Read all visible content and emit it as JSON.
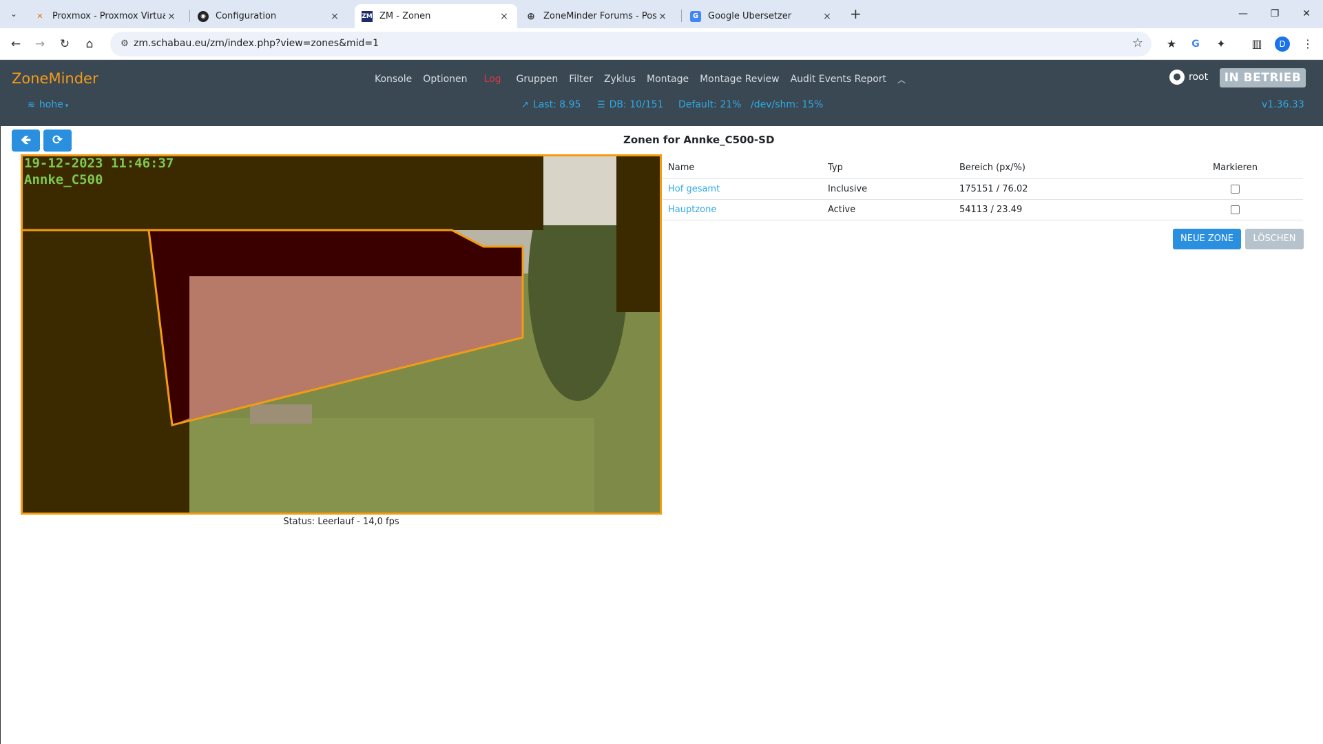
{
  "browser": {
    "tabs": [
      {
        "title": "Proxmox - Proxmox Virtual Env",
        "icon": "proxmox-icon",
        "active": false
      },
      {
        "title": "Configuration",
        "icon": "configuration-icon",
        "active": false
      },
      {
        "title": "ZM - Zonen",
        "icon": "zoneminder-icon",
        "active": true
      },
      {
        "title": "ZoneMinder Forums - Post a ne",
        "icon": "globe-icon",
        "active": false
      },
      {
        "title": "Google Übersetzer",
        "icon": "google-translate-icon",
        "active": false
      }
    ],
    "url": "zm.schabau.eu/zm/index.php?view=zones&mid=1",
    "profile_initial": "D"
  },
  "zm": {
    "brand": "ZoneMinder",
    "nav": {
      "konsole": "Konsole",
      "optionen": "Optionen",
      "log": "Log",
      "gruppen": "Gruppen",
      "filter": "Filter",
      "zyklus": "Zyklus",
      "montage": "Montage",
      "montage_review": "Montage Review",
      "audit": "Audit Events Report"
    },
    "user": "root",
    "run_state": "IN BETRIEB",
    "network": "hohe",
    "load": "Last: 8.95",
    "db": "DB: 10/151",
    "disk": "Default: 21%",
    "shm": "/dev/shm: 15%",
    "version": "v1.36.33"
  },
  "page": {
    "title": "Zonen for Annke_C500-SD",
    "camera_timestamp": "19-12-2023 11:46:37",
    "camera_name": "Annke_C500",
    "status": "Status: Leerlauf - 14,0 fps"
  },
  "zones_table": {
    "headers": {
      "name": "Name",
      "type": "Typ",
      "area": "Bereich (px/%)",
      "mark": "Markieren"
    },
    "rows": [
      {
        "name": "Hof gesamt",
        "type": "Inclusive",
        "area": "175151 / 76.02"
      },
      {
        "name": "Hauptzone",
        "type": "Active",
        "area": "54113 / 23.49"
      }
    ]
  },
  "buttons": {
    "new_zone": "NEUE ZONE",
    "delete": "LÖSCHEN"
  },
  "colors": {
    "header_bg": "#3a4853",
    "brand": "#f79b17",
    "accent": "#2a8fde",
    "link": "#30a9e6",
    "zone_outline": "#f39c12"
  }
}
